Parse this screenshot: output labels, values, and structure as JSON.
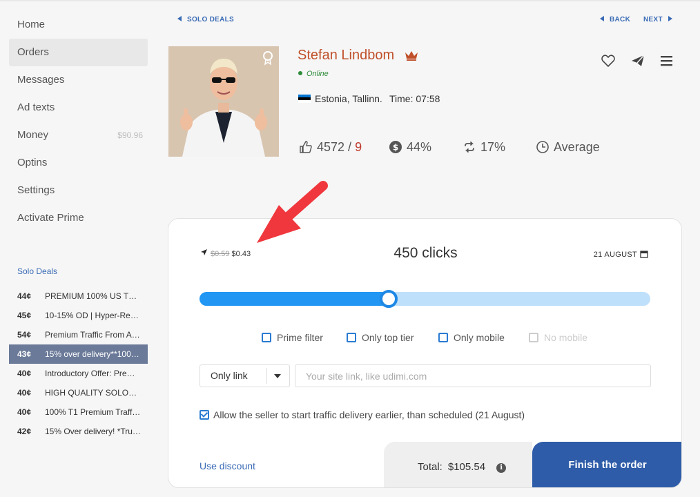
{
  "sidebar": {
    "items": [
      {
        "label": "Home",
        "amount": ""
      },
      {
        "label": "Orders",
        "amount": ""
      },
      {
        "label": "Messages",
        "amount": ""
      },
      {
        "label": "Ad texts",
        "amount": ""
      },
      {
        "label": "Money",
        "amount": "$90.96"
      },
      {
        "label": "Optins",
        "amount": ""
      },
      {
        "label": "Settings",
        "amount": ""
      },
      {
        "label": "Activate Prime",
        "amount": ""
      }
    ],
    "solo_title": "Solo Deals",
    "deals": [
      {
        "price": "44¢",
        "name": "PREMIUM 100% US T…"
      },
      {
        "price": "45¢",
        "name": "10-15% OD | Hyper-Re…"
      },
      {
        "price": "54¢",
        "name": "Premium Traffic From A…"
      },
      {
        "price": "43¢",
        "name": "15% over delivery**100…"
      },
      {
        "price": "40¢",
        "name": "Introductory Offer: Pre…"
      },
      {
        "price": "40¢",
        "name": "HIGH QUALITY SOLO…"
      },
      {
        "price": "40¢",
        "name": "100% T1 Premium Traff…"
      },
      {
        "price": "42¢",
        "name": "15% Over delivery! *Tru…"
      }
    ]
  },
  "topnav": {
    "solo_deals": "SOLO DEALS",
    "back": "BACK",
    "next": "NEXT"
  },
  "profile": {
    "name": "Stefan Lindbom",
    "status": "Online",
    "location": "Estonia, Tallinn.",
    "time": "Time: 07:58",
    "likes": "4572",
    "dislikes": "9",
    "stat_percent": "44%",
    "repeat_percent": "17%",
    "speed": "Average"
  },
  "order": {
    "old_price": "$0.59",
    "price": "$0.43",
    "clicks": "450 clicks",
    "date": "21 AUGUST",
    "slider_level": 0.42,
    "filters": [
      {
        "label": "Prime filter",
        "checked": false,
        "disabled": false
      },
      {
        "label": "Only top tier",
        "checked": false,
        "disabled": false
      },
      {
        "label": "Only mobile",
        "checked": false,
        "disabled": false
      },
      {
        "label": "No mobile",
        "checked": false,
        "disabled": true
      }
    ],
    "link_type": "Only link",
    "url_placeholder": "Your site link, like udimi.com",
    "allow_text": "Allow the seller to start traffic delivery earlier, than scheduled (21 August)",
    "discount": "Use discount",
    "total_label": "Total:",
    "total_value": "$105.54",
    "finish_label": "Finish the order"
  },
  "colors": {
    "accent": "#2196f3",
    "finish": "#2e5ca8",
    "name": "#c0502a",
    "arrow": "#f0373d"
  }
}
